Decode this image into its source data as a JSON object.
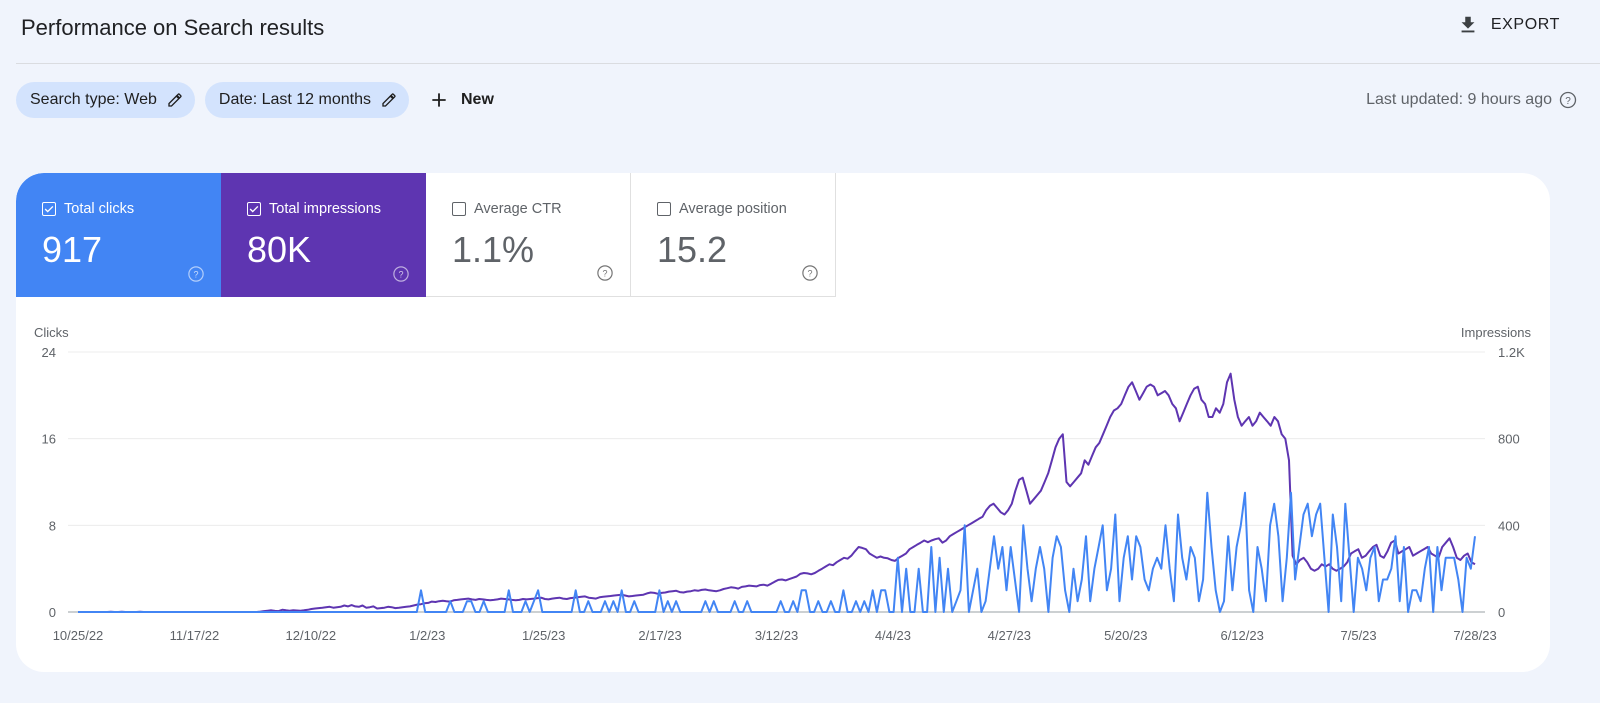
{
  "header": {
    "title": "Performance on Search results",
    "export_label": "EXPORT",
    "export_icon": "download-icon"
  },
  "filters": {
    "search_type": "Search type: Web",
    "date": "Date: Last 12 months",
    "new_label": "New",
    "edit_icon": "pencil-icon",
    "add_icon": "plus-icon"
  },
  "last_updated": "Last updated: 9 hours ago",
  "metrics": [
    {
      "label": "Total clicks",
      "value": "917",
      "checked": true,
      "color": "#4285f4"
    },
    {
      "label": "Total impressions",
      "value": "80K",
      "checked": true,
      "color": "#5e35b1"
    },
    {
      "label": "Average CTR",
      "value": "1.1%",
      "checked": false
    },
    {
      "label": "Average position",
      "value": "15.2",
      "checked": false
    }
  ],
  "chart_data": {
    "type": "line",
    "x_start": "10/25/22",
    "x_end": "7/28/23",
    "xticks": [
      "10/25/22",
      "11/17/22",
      "12/10/22",
      "1/2/23",
      "1/25/23",
      "2/17/23",
      "3/12/23",
      "4/4/23",
      "4/27/23",
      "5/20/23",
      "6/12/23",
      "7/5/23",
      "7/28/23"
    ],
    "left_axis": {
      "label": "Clicks",
      "ticks": [
        "0",
        "8",
        "16",
        "24"
      ],
      "range": [
        0,
        24
      ]
    },
    "right_axis": {
      "label": "Impressions",
      "ticks": [
        "0",
        "400",
        "800",
        "1.2K"
      ],
      "range": [
        0,
        1200
      ]
    },
    "grid": true,
    "series": [
      {
        "name": "Clicks",
        "axis": "left",
        "color": "#4285f4",
        "values": [
          0,
          0,
          0,
          0,
          0,
          0,
          0,
          0,
          0,
          0,
          0,
          0,
          0,
          0,
          0,
          0,
          0,
          0,
          0,
          0,
          0,
          0,
          0,
          0,
          0,
          0,
          0,
          0,
          0,
          0,
          0,
          0,
          0,
          0,
          0,
          0,
          0,
          0,
          0,
          0,
          0,
          0,
          0,
          0,
          0,
          0,
          0,
          0,
          0,
          0,
          0,
          0,
          0,
          0,
          0,
          0,
          0,
          0,
          0,
          0,
          0,
          0,
          0,
          0,
          0,
          0,
          0,
          0,
          0,
          0,
          0,
          0,
          0,
          0,
          0,
          0,
          0,
          0,
          0,
          0,
          0,
          0,
          2,
          0,
          0,
          0,
          0,
          0,
          0,
          1,
          0,
          0,
          0,
          1,
          1,
          0,
          0,
          1,
          0,
          0,
          0,
          0,
          0,
          2,
          0,
          0,
          0,
          1,
          0,
          1,
          2,
          0,
          0,
          0,
          0,
          0,
          0,
          0,
          0,
          2,
          0,
          0,
          1,
          0,
          0,
          0,
          1,
          0,
          1,
          0,
          2,
          0,
          0,
          1,
          0,
          0,
          0,
          0,
          0,
          2,
          0,
          1,
          0,
          1,
          0,
          0,
          0,
          0,
          0,
          0,
          1,
          0,
          1,
          0,
          0,
          0,
          0,
          1,
          0,
          0,
          1,
          0,
          0,
          0,
          0,
          0,
          0,
          0,
          1,
          0,
          0,
          1,
          0,
          2,
          2,
          0,
          0,
          1,
          0,
          0,
          1,
          0,
          0,
          2,
          0,
          0,
          1,
          0,
          1,
          0,
          2,
          0,
          2,
          2,
          0,
          0,
          5,
          0,
          4,
          0,
          0,
          4,
          0,
          0,
          6,
          0,
          5,
          0,
          4,
          0,
          1,
          2,
          8,
          0,
          2,
          4,
          0,
          1,
          4,
          7,
          4,
          6,
          2,
          6,
          3,
          0,
          8,
          4,
          1,
          4,
          6,
          4,
          0,
          5,
          7,
          6,
          2,
          0,
          4,
          1,
          3,
          7,
          1,
          4,
          6,
          8,
          2,
          4,
          9,
          1,
          5,
          7,
          3,
          7,
          6,
          3,
          2,
          4,
          5,
          4,
          8,
          4,
          1,
          9,
          5,
          3,
          6,
          5,
          1,
          3,
          11,
          6,
          2,
          0,
          1,
          7,
          2,
          6,
          8,
          11,
          2,
          0,
          6,
          4,
          1,
          8,
          10,
          7,
          1,
          5,
          11,
          3,
          6,
          9,
          10,
          7,
          9,
          10,
          5,
          0,
          9,
          6,
          1,
          10,
          5,
          0,
          5,
          4,
          2,
          5,
          6,
          1,
          3,
          3,
          4,
          7,
          1,
          6,
          0,
          2,
          2,
          1,
          4,
          6,
          0,
          6,
          2,
          5,
          5,
          5,
          3,
          0,
          5,
          4,
          7
        ],
        "note": "approximate daily values read from chart"
      },
      {
        "name": "Impressions",
        "axis": "right",
        "color": "#5e35b1",
        "values": [
          0,
          0,
          0,
          0,
          0,
          0,
          0,
          0,
          0,
          1,
          0,
          0,
          1,
          0,
          0,
          0,
          0,
          1,
          0,
          0,
          0,
          0,
          0,
          0,
          0,
          0,
          0,
          0,
          0,
          0,
          0,
          0,
          0,
          0,
          0,
          0,
          0,
          0,
          0,
          0,
          0,
          0,
          0,
          0,
          0,
          0,
          0,
          0,
          0,
          0,
          2,
          4,
          6,
          8,
          5,
          4,
          10,
          8,
          6,
          8,
          7,
          6,
          8,
          10,
          14,
          16,
          18,
          20,
          22,
          24,
          20,
          22,
          24,
          30,
          26,
          32,
          26,
          24,
          30,
          20,
          22,
          26,
          16,
          18,
          20,
          24,
          22,
          18,
          20,
          22,
          24,
          26,
          30,
          34,
          36,
          40,
          42,
          48,
          46,
          50,
          52,
          50,
          48,
          54,
          56,
          58,
          60,
          62,
          58,
          56,
          60,
          58,
          56,
          54,
          56,
          58,
          62,
          60,
          58,
          56,
          54,
          56,
          60,
          58,
          60,
          62,
          64,
          66,
          60,
          58,
          62,
          64,
          66,
          62,
          60,
          64,
          66,
          68,
          70,
          72,
          66,
          64,
          62,
          68,
          70,
          72,
          74,
          76,
          78,
          80,
          76,
          72,
          74,
          76,
          78,
          80,
          86,
          90,
          88,
          84,
          88,
          90,
          94,
          96,
          98,
          92,
          90,
          94,
          96,
          100,
          98,
          102,
          104,
          100,
          98,
          96,
          100,
          106,
          110,
          114,
          112,
          108,
          116,
          118,
          122,
          120,
          118,
          124,
          126,
          122,
          130,
          140,
          148,
          150,
          146,
          152,
          158,
          164,
          176,
          180,
          178,
          174,
          180,
          190,
          200,
          210,
          220,
          216,
          230,
          240,
          250,
          246,
          260,
          280,
          300,
          296,
          290,
          270,
          260,
          250,
          256,
          250,
          248,
          240,
          236,
          250,
          260,
          270,
          290,
          300,
          310,
          320,
          330,
          322,
          330,
          336,
          340,
          320,
          330,
          350,
          360,
          370,
          380,
          390,
          400,
          410,
          420,
          430,
          440,
          470,
          490,
          500,
          480,
          460,
          450,
          470,
          500,
          560,
          610,
          620,
          560,
          500,
          520,
          540,
          560,
          600,
          640,
          700,
          760,
          800,
          820,
          600,
          580,
          600,
          620,
          640,
          700,
          680,
          720,
          760,
          780,
          820,
          860,
          900,
          930,
          940,
          960,
          1000,
          1040,
          1060,
          1020,
          980,
          1010,
          1040,
          1050,
          1040,
          1000,
          1010,
          1020,
          1000,
          960,
          940,
          880,
          920,
          960,
          1000,
          1030,
          1040,
          980,
          960,
          900,
          900,
          940,
          920,
          960,
          1060,
          1100,
          980,
          900,
          860,
          880,
          900,
          860,
          880,
          920,
          900,
          880,
          860,
          900,
          880,
          820,
          800,
          700,
          260,
          220,
          240,
          250,
          230,
          200,
          190,
          200,
          220,
          210,
          220,
          200,
          190,
          200,
          210,
          230,
          270,
          280,
          290,
          250,
          260,
          280,
          300,
          310,
          260,
          250,
          280,
          320,
          330,
          270,
          280,
          290,
          300,
          260,
          270,
          280,
          290,
          300,
          270,
          260,
          250,
          300,
          320,
          340,
          300,
          250,
          240,
          260,
          270,
          230,
          220
        ]
      }
    ]
  }
}
